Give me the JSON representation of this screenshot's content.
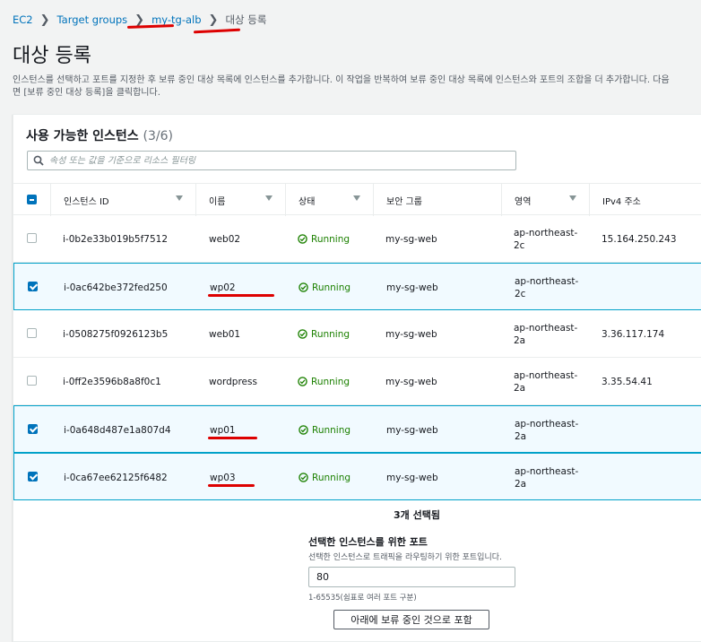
{
  "breadcrumb": {
    "items": [
      "EC2",
      "Target groups",
      "my-tg-alb"
    ],
    "current": "대상 등록"
  },
  "page": {
    "title": "대상 등록",
    "description_line1": "인스턴스를 선택하고 포트를 지정한 후 보류 중인 대상 목록에 인스턴스를 추가합니다. 이 작업을 반복하여 보류 중인 대상 목록에 인스턴스와 포트의 조합을 더 추가합니다. 다음",
    "description_line2": "면 [보류 중인 대상 등록]을 클릭합니다."
  },
  "panel": {
    "title": "사용 가능한 인스턴스",
    "count": "(3/6)",
    "search_placeholder": "속성 또는 값을 기준으로 리소스 필터링"
  },
  "columns": [
    "인스턴스 ID",
    "이름",
    "상태",
    "보안 그룹",
    "영역",
    "IPv4 주소"
  ],
  "rows": [
    {
      "id": "i-0b2e33b019b5f7512",
      "name": "web02",
      "status": "Running",
      "sg": "my-sg-web",
      "az1": "ap-northeast-",
      "az2": "2c",
      "ip": "15.164.250.243",
      "selected": false
    },
    {
      "id": "i-0ac642be372fed250",
      "name": "wp02",
      "status": "Running",
      "sg": "my-sg-web",
      "az1": "ap-northeast-",
      "az2": "2c",
      "ip": "",
      "selected": true
    },
    {
      "id": "i-0508275f0926123b5",
      "name": "web01",
      "status": "Running",
      "sg": "my-sg-web",
      "az1": "ap-northeast-",
      "az2": "2a",
      "ip": "3.36.117.174",
      "selected": false
    },
    {
      "id": "i-0ff2e3596b8a8f0c1",
      "name": "wordpress",
      "status": "Running",
      "sg": "my-sg-web",
      "az1": "ap-northeast-",
      "az2": "2a",
      "ip": "3.35.54.41",
      "selected": false
    },
    {
      "id": "i-0a648d487e1a807d4",
      "name": "wp01",
      "status": "Running",
      "sg": "my-sg-web",
      "az1": "ap-northeast-",
      "az2": "2a",
      "ip": "",
      "selected": true
    },
    {
      "id": "i-0ca67ee62125f6482",
      "name": "wp03",
      "status": "Running",
      "sg": "my-sg-web",
      "az1": "ap-northeast-",
      "az2": "2a",
      "ip": "",
      "selected": true
    }
  ],
  "selection": {
    "count_text": "3개 선택됨"
  },
  "port": {
    "label": "선택한 인스턴스를 위한 포트",
    "help": "선택한 인스턴스로 트래픽을 라우팅하기 위한 포트입니다.",
    "value": "80",
    "range": "1-65535(쉼표로 여러 포트 구분)"
  },
  "include_button": "아래에 보류 중인 것으로 포함",
  "colors": {
    "link": "#0073bb",
    "running": "#1d8102",
    "selected_border": "#00a1c9",
    "annotation": "#dd0000"
  }
}
